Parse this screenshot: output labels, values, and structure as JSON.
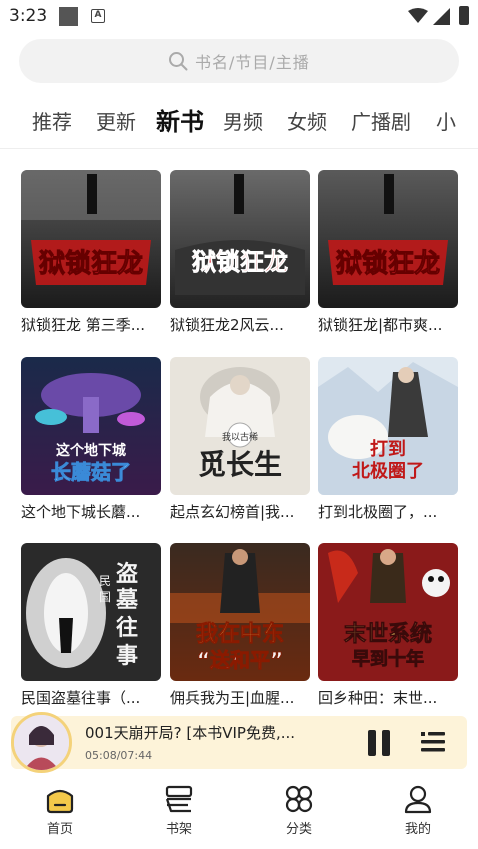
{
  "status": {
    "time": "3:23"
  },
  "search": {
    "placeholder": "书名/节目/主播"
  },
  "tabs": [
    "推荐",
    "更新",
    "新书",
    "男频",
    "女频",
    "广播剧",
    "小"
  ],
  "active_tab": "新书",
  "books": [
    {
      "title": "狱锁狂龙 第三季...",
      "cover_text": "狱锁狂龙"
    },
    {
      "title": "狱锁狂龙2风云...",
      "cover_text": "狱锁狂龙"
    },
    {
      "title": "狱锁狂龙|都市爽...",
      "cover_text": "狱锁狂龙"
    },
    {
      "title": "这个地下城长蘑...",
      "cover_text": "这个地下城长蘑菇了"
    },
    {
      "title": "起点玄幻榜首|我...",
      "cover_text": "我以古稀觅长生"
    },
    {
      "title": "打到北极圈了，...",
      "cover_text": "打到北极圈了"
    },
    {
      "title": "民国盗墓往事（...",
      "cover_text": "民国盗墓往事"
    },
    {
      "title": "佣兵我为王|血腥...",
      "cover_text": "我在中东送和平"
    },
    {
      "title": "回乡种田：末世...",
      "cover_text": "末世系统早到十年"
    }
  ],
  "player": {
    "title": "001天崩开局?  [本书VIP免费,...",
    "time": "05:08/07:44"
  },
  "nav": [
    {
      "label": "首页",
      "icon": "home-icon"
    },
    {
      "label": "书架",
      "icon": "bookshelf-icon"
    },
    {
      "label": "分类",
      "icon": "category-icon"
    },
    {
      "label": "我的",
      "icon": "profile-icon"
    }
  ],
  "colors": {
    "accent": "#f4c94a",
    "player_bg": "#fdf3d9"
  }
}
